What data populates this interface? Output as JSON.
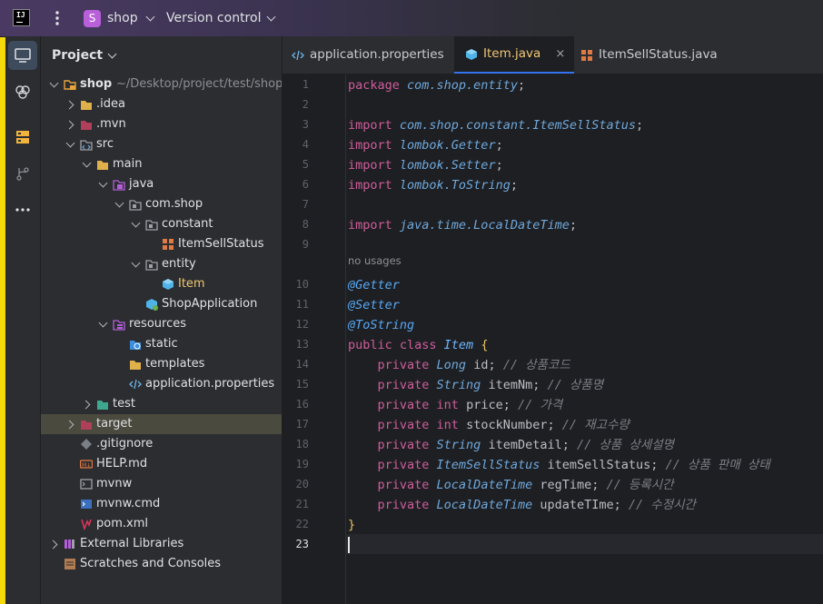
{
  "titlebar": {
    "logo_text": "IJ",
    "project_badge": "S",
    "project_name": "shop",
    "vcs_label": "Version control"
  },
  "panel": {
    "title": "Project",
    "tree": [
      {
        "label": "shop",
        "extra": "~/Desktop/project/test/shop",
        "icon": "project-folder-icon",
        "depth": 0,
        "arrow": "open"
      },
      {
        "label": ".idea",
        "icon": "folder-icon",
        "depth": 1,
        "arrow": "closed"
      },
      {
        "label": ".mvn",
        "icon": "excluded-folder-icon",
        "depth": 1,
        "arrow": "closed"
      },
      {
        "label": "src",
        "icon": "source-folder-icon",
        "depth": 1,
        "arrow": "open"
      },
      {
        "label": "main",
        "icon": "folder-icon",
        "depth": 2,
        "arrow": "open"
      },
      {
        "label": "java",
        "icon": "java-source-folder-icon",
        "depth": 3,
        "arrow": "open"
      },
      {
        "label": "com.shop",
        "icon": "package-icon",
        "depth": 4,
        "arrow": "open"
      },
      {
        "label": "constant",
        "icon": "package-icon",
        "depth": 5,
        "arrow": "open"
      },
      {
        "label": "ItemSellStatus",
        "icon": "enum-icon",
        "depth": 6,
        "arrow": "none"
      },
      {
        "label": "entity",
        "icon": "package-icon",
        "depth": 5,
        "arrow": "open"
      },
      {
        "label": "Item",
        "icon": "class-icon",
        "depth": 6,
        "arrow": "none",
        "active": true
      },
      {
        "label": "ShopApplication",
        "icon": "spring-app-icon",
        "depth": 5,
        "arrow": "none"
      },
      {
        "label": "resources",
        "icon": "resources-folder-icon",
        "depth": 3,
        "arrow": "open"
      },
      {
        "label": "static",
        "icon": "web-folder-icon",
        "depth": 4,
        "arrow": "none"
      },
      {
        "label": "templates",
        "icon": "folder-icon",
        "depth": 4,
        "arrow": "none"
      },
      {
        "label": "application.properties",
        "icon": "properties-file-icon",
        "depth": 4,
        "arrow": "none"
      },
      {
        "label": "test",
        "icon": "test-folder-icon",
        "depth": 2,
        "arrow": "closed"
      },
      {
        "label": "target",
        "icon": "excluded-folder-icon",
        "depth": 1,
        "arrow": "closed",
        "highlight": true
      },
      {
        "label": ".gitignore",
        "icon": "gitignore-file-icon",
        "depth": 1,
        "arrow": "none"
      },
      {
        "label": "HELP.md",
        "icon": "markdown-file-icon",
        "depth": 1,
        "arrow": "none"
      },
      {
        "label": "mvnw",
        "icon": "shell-file-icon",
        "depth": 1,
        "arrow": "none"
      },
      {
        "label": "mvnw.cmd",
        "icon": "cmd-file-icon",
        "depth": 1,
        "arrow": "none"
      },
      {
        "label": "pom.xml",
        "icon": "maven-file-icon",
        "depth": 1,
        "arrow": "none"
      },
      {
        "label": "External Libraries",
        "icon": "libraries-icon",
        "depth": 0,
        "arrow": "closed"
      },
      {
        "label": "Scratches and Consoles",
        "icon": "scratches-icon",
        "depth": 0,
        "arrow": "none"
      }
    ]
  },
  "tabs": [
    {
      "label": "application.properties",
      "icon": "properties-file-icon",
      "active": false
    },
    {
      "label": "Item.java",
      "icon": "class-icon",
      "active": true,
      "close": "×"
    },
    {
      "label": "ItemSellStatus.java",
      "icon": "enum-icon",
      "active": false
    }
  ],
  "editor": {
    "usage_hint": "no usages",
    "lines": [
      {
        "n": "1",
        "tokens": [
          [
            "pk",
            "package "
          ],
          [
            "ty",
            "com.shop.entity"
          ],
          [
            "pl",
            ";"
          ]
        ]
      },
      {
        "n": "2",
        "tokens": []
      },
      {
        "n": "3",
        "tokens": [
          [
            "pk",
            "import "
          ],
          [
            "ty",
            "com.shop.constant.ItemSellStatus"
          ],
          [
            "pl",
            ";"
          ]
        ]
      },
      {
        "n": "4",
        "tokens": [
          [
            "pk",
            "import "
          ],
          [
            "ty",
            "lombok.Getter"
          ],
          [
            "pl",
            ";"
          ]
        ]
      },
      {
        "n": "5",
        "tokens": [
          [
            "pk",
            "import "
          ],
          [
            "ty",
            "lombok.Setter"
          ],
          [
            "pl",
            ";"
          ]
        ]
      },
      {
        "n": "6",
        "tokens": [
          [
            "pk",
            "import "
          ],
          [
            "ty",
            "lombok.ToString"
          ],
          [
            "pl",
            ";"
          ]
        ]
      },
      {
        "n": "7",
        "tokens": []
      },
      {
        "n": "8",
        "tokens": [
          [
            "pk",
            "import "
          ],
          [
            "ty",
            "java.time.LocalDateTime"
          ],
          [
            "pl",
            ";"
          ]
        ]
      },
      {
        "n": "9",
        "tokens": []
      },
      {
        "n": "10",
        "tokens": [
          [
            "an",
            "@Getter"
          ]
        ]
      },
      {
        "n": "11",
        "tokens": [
          [
            "an",
            "@Setter"
          ]
        ]
      },
      {
        "n": "12",
        "tokens": [
          [
            "an",
            "@ToString"
          ]
        ]
      },
      {
        "n": "13",
        "tokens": [
          [
            "pk",
            "public class "
          ],
          [
            "cl",
            "Item "
          ],
          [
            "br",
            "{"
          ]
        ]
      },
      {
        "n": "14",
        "tokens": [
          [
            "pl",
            "    "
          ],
          [
            "pk",
            "private "
          ],
          [
            "ty",
            "Long "
          ],
          [
            "pl",
            "id; "
          ],
          [
            "cm",
            "// 상품코드"
          ]
        ]
      },
      {
        "n": "15",
        "tokens": [
          [
            "pl",
            "    "
          ],
          [
            "pk",
            "private "
          ],
          [
            "ty",
            "String "
          ],
          [
            "pl",
            "itemNm; "
          ],
          [
            "cm",
            "// 상품명"
          ]
        ]
      },
      {
        "n": "16",
        "tokens": [
          [
            "pl",
            "    "
          ],
          [
            "pk",
            "private int "
          ],
          [
            "pl",
            "price; "
          ],
          [
            "cm",
            "// 가격"
          ]
        ]
      },
      {
        "n": "17",
        "tokens": [
          [
            "pl",
            "    "
          ],
          [
            "pk",
            "private int "
          ],
          [
            "pl",
            "stockNumber; "
          ],
          [
            "cm",
            "// 재고수량"
          ]
        ]
      },
      {
        "n": "18",
        "tokens": [
          [
            "pl",
            "    "
          ],
          [
            "pk",
            "private "
          ],
          [
            "ty",
            "String "
          ],
          [
            "pl",
            "itemDetail; "
          ],
          [
            "cm",
            "// 상품 상세설명"
          ]
        ]
      },
      {
        "n": "19",
        "tokens": [
          [
            "pl",
            "    "
          ],
          [
            "pk",
            "private "
          ],
          [
            "ty",
            "ItemSellStatus "
          ],
          [
            "pl",
            "itemSellStatus; "
          ],
          [
            "cm",
            "// 상품 판매 상태"
          ]
        ]
      },
      {
        "n": "20",
        "tokens": [
          [
            "pl",
            "    "
          ],
          [
            "pk",
            "private "
          ],
          [
            "ty",
            "LocalDateTime "
          ],
          [
            "pl",
            "regTime; "
          ],
          [
            "cm",
            "// 등록시간"
          ]
        ]
      },
      {
        "n": "21",
        "tokens": [
          [
            "pl",
            "    "
          ],
          [
            "pk",
            "private "
          ],
          [
            "ty",
            "LocalDateTime "
          ],
          [
            "pl",
            "updateTIme; "
          ],
          [
            "cm",
            "// 수정시간"
          ]
        ]
      },
      {
        "n": "22",
        "tokens": [
          [
            "br",
            "}"
          ]
        ]
      },
      {
        "n": "23",
        "tokens": [],
        "current": true
      }
    ]
  },
  "colors": {
    "accent": "#3574f0",
    "caret_edge": "#f5d90a"
  }
}
